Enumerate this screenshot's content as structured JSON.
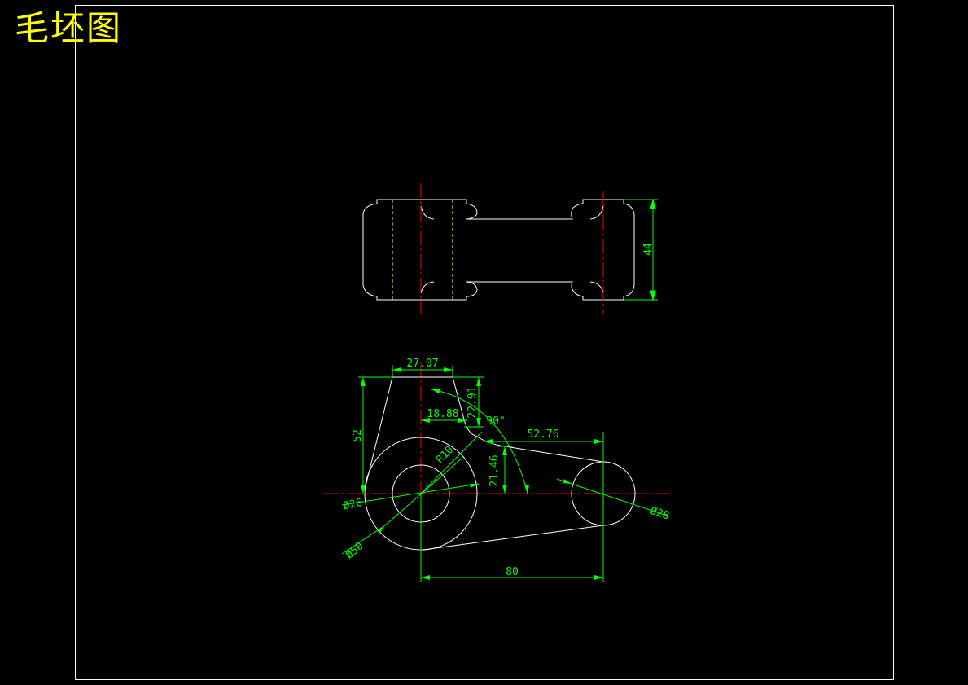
{
  "title": "毛坯图",
  "colors": {
    "background": "#000000",
    "outline": "#ffffff",
    "centerline": "#ff0000",
    "hidden": "#ffff66",
    "dimension": "#00ff00",
    "title": "#ffff00"
  },
  "dimensions": {
    "height_44": "44",
    "width_27_07": "27.07",
    "height_52": "52",
    "depth_22_91": "22.91",
    "offset_18_88": "18.88",
    "angle_90": "90°",
    "length_52_76": "52.76",
    "radius_r10": "R10",
    "height_21_46": "21.46",
    "dia_26": "Ø26",
    "dia_50": "Ø50",
    "dia_28": "Ø28",
    "length_80": "80"
  }
}
